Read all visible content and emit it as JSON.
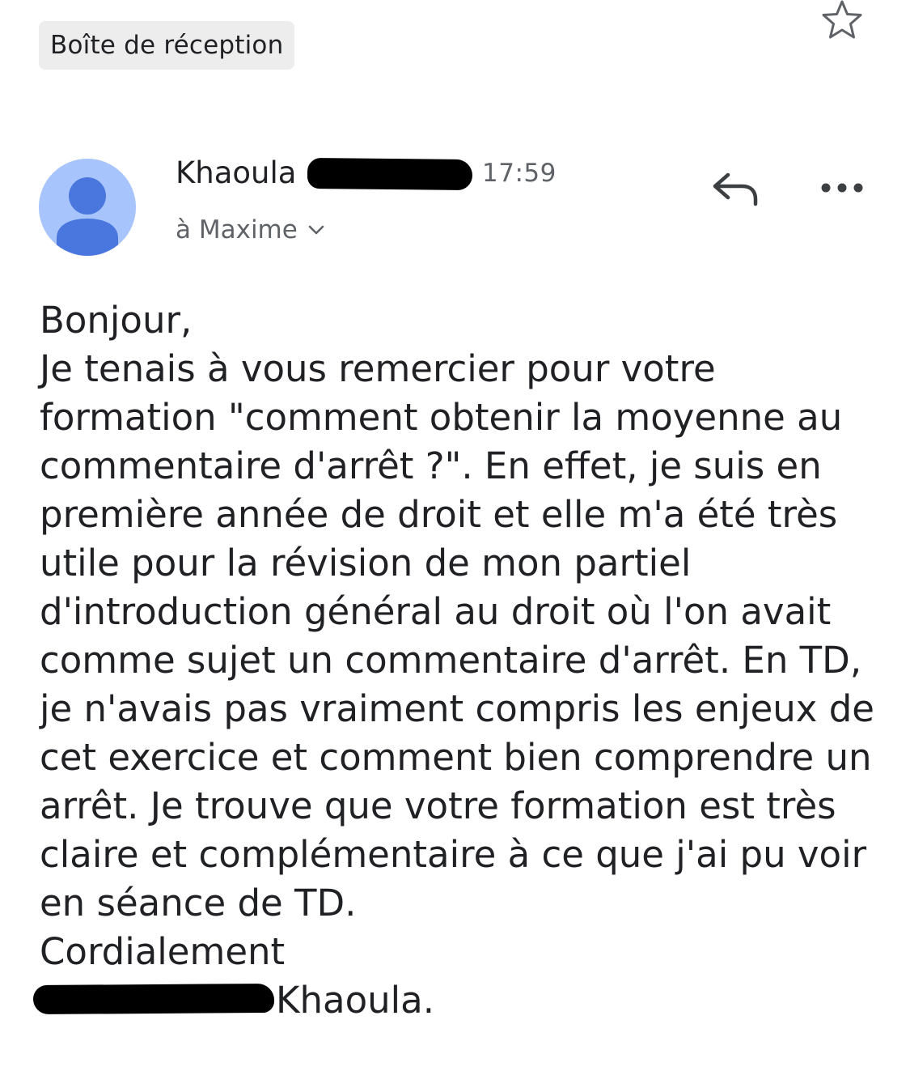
{
  "header": {
    "label_chip": "Boîte de réception",
    "star_icon": "star-outline-icon"
  },
  "message": {
    "sender_first_name": "Khaoula",
    "time": "17:59",
    "recipient": "à Maxime",
    "avatar_icon": "person-icon",
    "avatar_color": "#a7c4fc",
    "avatar_figure_color": "#4a77de",
    "reply_icon": "reply-icon",
    "more_icon": "more-horizontal-icon",
    "expand_icon": "chevron-down-icon"
  },
  "body": {
    "lines": [
      "Bonjour,",
      "Je tenais à vous remercier pour votre",
      "formation \"comment obtenir la moyenne au",
      "commentaire d'arrêt ?\". En effet, je suis en",
      "première année de droit et elle m'a été très",
      "utile pour la révision de mon partiel",
      "d'introduction général au droit où l'on avait",
      "comme sujet un commentaire d'arrêt. En TD,",
      "je n'avais pas vraiment compris les enjeux de",
      "cet exercice et comment bien comprendre un",
      "arrêt. Je trouve que votre formation est très",
      "claire et complémentaire à ce que j'ai pu voir",
      "en séance de TD.",
      "Cordialement"
    ],
    "signature": "Khaoula."
  }
}
